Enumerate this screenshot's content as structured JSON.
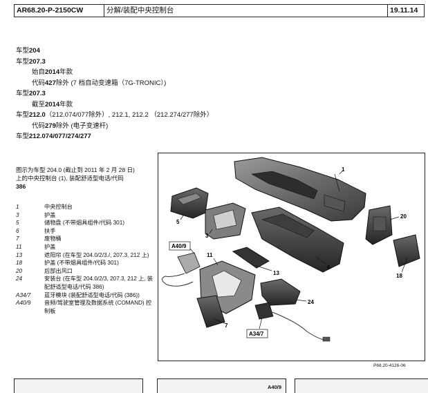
{
  "header": {
    "code": "AR68.20-P-2150CW",
    "title": "分解/装配中央控制台",
    "date": "19.11.14"
  },
  "models": [
    {
      "prefix": "车型",
      "bold": "204",
      "rest": "",
      "indent": false
    },
    {
      "prefix": "车型",
      "bold": "207.3",
      "rest": "",
      "indent": false
    },
    {
      "prefix": "始自",
      "bold": "2014",
      "rest": "年款",
      "indent": true
    },
    {
      "prefix": "代码",
      "bold": "427",
      "rest": "除外 (7 档自动变速箱（7G-TRONIC）)",
      "indent": true
    },
    {
      "prefix": "车型",
      "bold": "207.3",
      "rest": "",
      "indent": false
    },
    {
      "prefix": "截至",
      "bold": "2014",
      "rest": "年款",
      "indent": true
    },
    {
      "prefix": "车型",
      "bold": "212.0",
      "rest": "（212.074/077除外）, 212.1, 212.2 （212.274/277除外）",
      "indent": false
    },
    {
      "prefix": "代码",
      "bold": "279",
      "rest": "除外 (电子变速杆)",
      "indent": true
    },
    {
      "prefix": "车型",
      "bold": "212.074/077/274/277",
      "rest": "",
      "indent": false
    }
  ],
  "caption": {
    "line1": "图示为车型 204.0 (截止到 2011 年 2 月 28 日)",
    "line2": "上的中央控制台 (1), 装配舒适型电话/代码",
    "line3": "386"
  },
  "legend": [
    {
      "num": "1",
      "text": "中央控制台"
    },
    {
      "num": "3",
      "text": "护盖"
    },
    {
      "num": "5",
      "text": "储物盘 (不带烟具组件/代码 301)"
    },
    {
      "num": "6",
      "text": "扶手"
    },
    {
      "num": "7",
      "text": "废物桶"
    },
    {
      "num": "11",
      "text": "护盖"
    },
    {
      "num": "13",
      "text": "遮阳帘 (在车型 204.0/2/3./, 207.3, 212 上)"
    },
    {
      "num": "18",
      "text": "护盖 (不带烟具组件/代码 301)"
    },
    {
      "num": "20",
      "text": "后部出风口"
    },
    {
      "num": "24",
      "text": "安装台 (在车型 204.0/2/3, 207.3, 212 上, 装配舒适型电话/代码 386)"
    },
    {
      "num": "A34/7",
      "text": "蓝牙模块 (装配舒适型电话/代码 (386))"
    },
    {
      "num": "A40/9",
      "text": "音频/驾驶室管理及数据系统 (COMAND) 控制板"
    }
  ],
  "figure": {
    "ref": "P68.20-4126-06",
    "callouts": [
      "1",
      "5",
      "3",
      "20",
      "6",
      "A40/9",
      "11",
      "13",
      "18",
      "24",
      "7",
      "A34/7"
    ]
  },
  "thumbs": {
    "label": "A40/9"
  }
}
